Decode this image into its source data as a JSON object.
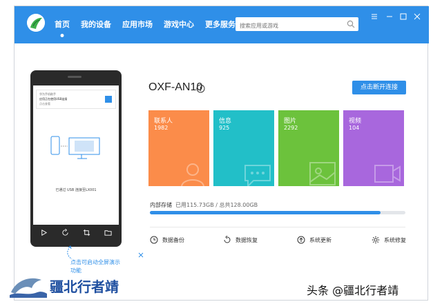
{
  "header": {
    "nav": [
      {
        "label": "首页",
        "active": true
      },
      {
        "label": "我的设备"
      },
      {
        "label": "应用市场"
      },
      {
        "label": "游戏中心"
      },
      {
        "label": "更多服务"
      }
    ],
    "search_placeholder": "搜索应用或游戏",
    "accent_color": "#2f8fe8"
  },
  "phone_preview": {
    "caption": "已通过 USB 连接至LX001",
    "notification_lines": [
      "华为手机助手",
      "应用正在使用USB连接",
      "点击查看"
    ],
    "toolbar_icons": [
      "play-icon",
      "refresh-icon",
      "crop-icon",
      "folder-icon"
    ]
  },
  "hint": {
    "text": "点击可启动全屏演示功能"
  },
  "watermark_text": "疆北行者靖",
  "device": {
    "name": "OXF-AN10",
    "connect_button": "点击断开连接"
  },
  "tiles": [
    {
      "title": "联系人",
      "count": "1982",
      "color": "#fb8c4a",
      "icon": "contact-icon"
    },
    {
      "title": "信息",
      "count": "925",
      "color": "#22bfc8",
      "icon": "message-icon"
    },
    {
      "title": "图片",
      "count": "2292",
      "color": "#6cc23c",
      "icon": "image-icon"
    },
    {
      "title": "视频",
      "count": "104",
      "color": "#a867dd",
      "icon": "video-icon"
    }
  ],
  "storage": {
    "label": "内部存储",
    "used_text": "已用115.73GB / 总共128.00GB",
    "used_fraction": 0.904
  },
  "actions": [
    {
      "label": "数据备份",
      "icon": "backup-icon"
    },
    {
      "label": "数据恢复",
      "icon": "restore-icon"
    },
    {
      "label": "系统更新",
      "icon": "update-icon"
    },
    {
      "label": "系统修复",
      "icon": "repair-icon"
    }
  ],
  "credit": "头条 @疆北行者靖"
}
